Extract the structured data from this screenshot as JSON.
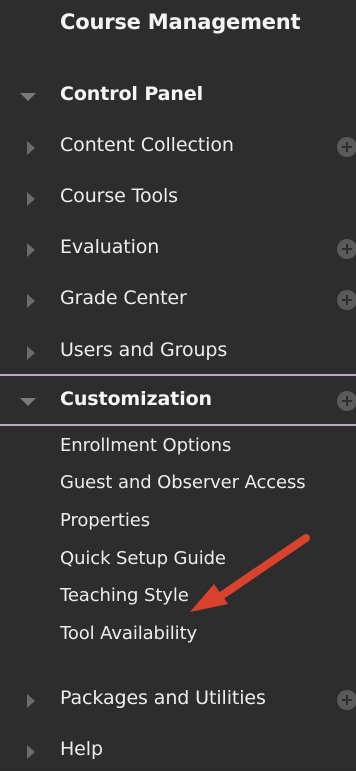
{
  "header": {
    "title": "Course Management"
  },
  "control_panel": {
    "label": "Control Panel",
    "items": [
      {
        "label": "Content Collection",
        "has_add": true
      },
      {
        "label": "Course Tools",
        "has_add": false
      },
      {
        "label": "Evaluation",
        "has_add": true
      },
      {
        "label": "Grade Center",
        "has_add": true
      },
      {
        "label": "Users and Groups",
        "has_add": false
      }
    ]
  },
  "customization": {
    "label": "Customization",
    "has_add": true,
    "items": [
      {
        "label": "Enrollment Options"
      },
      {
        "label": "Guest and Observer Access"
      },
      {
        "label": "Properties"
      },
      {
        "label": "Quick Setup Guide"
      },
      {
        "label": "Teaching Style"
      },
      {
        "label": "Tool Availability"
      }
    ]
  },
  "bottom_items": [
    {
      "label": "Packages and Utilities",
      "has_add": true
    },
    {
      "label": "Help",
      "has_add": false
    }
  ],
  "annotation": {
    "color": "#d9432e"
  },
  "colors": {
    "panel_bg": "#2d2d2d",
    "highlight_border": "#b7a9c8",
    "text": "#ededed"
  }
}
